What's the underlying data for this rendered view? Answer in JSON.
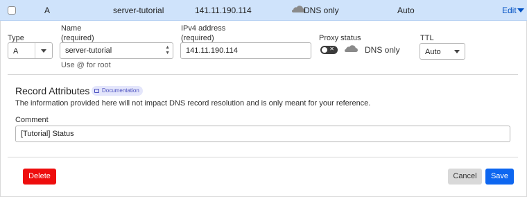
{
  "record_row": {
    "type": "A",
    "name": "server-tutorial",
    "content": "141.11.190.114",
    "proxy_status": "DNS only",
    "ttl": "Auto",
    "edit_label": "Edit"
  },
  "form": {
    "type": {
      "label": "Type",
      "value": "A"
    },
    "name": {
      "label": "Name",
      "required_note": "(required)",
      "value": "server-tutorial",
      "hint": "Use @ for root"
    },
    "ipv4": {
      "label": "IPv4 address",
      "required_note": "(required)",
      "value": "141.11.190.114"
    },
    "proxy": {
      "label": "Proxy status",
      "toggle_state": "off",
      "toggle_glyph": "✕",
      "value": "DNS only"
    },
    "ttl": {
      "label": "TTL",
      "value": "Auto"
    }
  },
  "record_attributes": {
    "title": "Record Attributes",
    "documentation_label": "Documentation",
    "description": "The information provided here will not impact DNS record resolution and is only meant for your reference.",
    "comment": {
      "label": "Comment",
      "value": "[Tutorial] Status"
    }
  },
  "actions": {
    "delete_label": "Delete",
    "cancel_label": "Cancel",
    "save_label": "Save"
  },
  "colors": {
    "row_highlight": "#cfe3fb",
    "link": "#0051c3",
    "delete": "#ee0d0d",
    "save": "#0d66f0",
    "cancel": "#d9d9d9",
    "doc_badge": "#e4e6fb"
  },
  "icons": {
    "cloud": "cloud-icon",
    "book": "book-icon",
    "caret": "chevron-down-icon"
  }
}
